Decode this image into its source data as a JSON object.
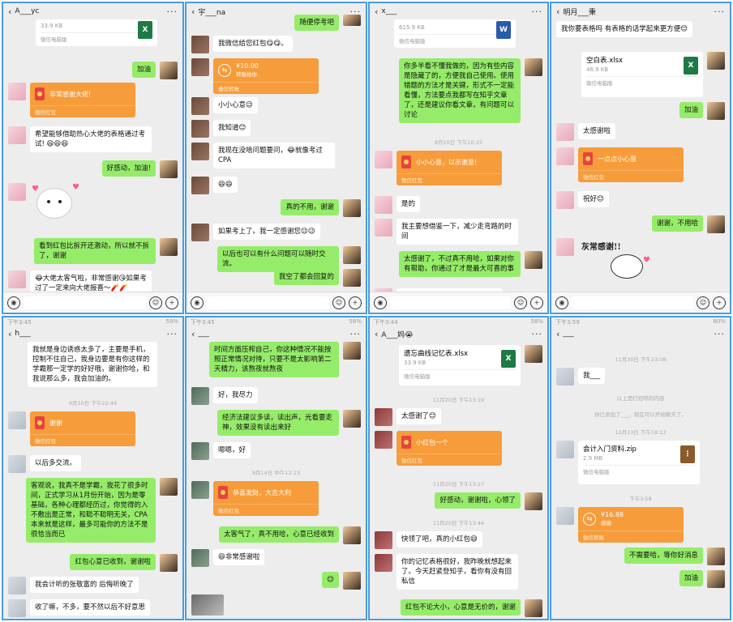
{
  "panels": [
    {
      "title": "A___yc",
      "messages": {
        "file_size": "33.9 KB",
        "file_source": "微信电脑版",
        "m1": "加油",
        "rp1": "非常感谢大佬!",
        "rp_label": "微信红包",
        "m2": "希望能够借助热心大佬的表格通过考试! 😆😆😆",
        "m3": "好感动，加油!",
        "m4": "看到红包比拆开还激动，所以就不拆了，谢谢",
        "m5": "😂大佬太客气啦，非常感谢😘如果考过了一定来向大佬报喜～🧨🧨"
      }
    },
    {
      "title": "宇___na",
      "messages": {
        "m0": "随便停考吧",
        "m1": "我微信给您红包😋😋。",
        "xfer_amount": "¥10.00",
        "xfer_label": "转账给你",
        "xfer_foot": "微信转账",
        "m2": "小小心意😉",
        "m3": "我知道😊",
        "m4": "我现在没啥问题要问，😂就像考过CPA",
        "m5": "😆😆",
        "m6": "真的不用，谢谢",
        "m7": "如果考上了。我一定感谢您😉😉",
        "m8": "以后也可以有什么问题可以随时交流。",
        "m9": "我空了都会回复的"
      }
    },
    {
      "title": "x___",
      "messages": {
        "file_size": "615.9 KB",
        "file_source": "微信电脑版",
        "m1": "你多半看不懂我做的，因为有些内容是隐藏了的，方便我自己使用。使用错题的方法才是关键，形式不一定能看懂，方法要点我都写在知乎文章了，还是建议你看文章，有问题可以讨论",
        "time": "8月10日 下午10:25",
        "rp1": "小小心意，以示谢意!",
        "rp_label": "微信红包",
        "m2": "是的",
        "m3": "我主要想借鉴一下，减少走弯路的时间",
        "m4": "太感谢了，不过真不用哈，如果对你有帮助，你通过了才是最大可喜的事",
        "m5": "我下是多分这文面的，我是老中"
      }
    },
    {
      "title": "明月___秉",
      "messages": {
        "m0": "我你要表格吗 有表格的话学起来更方便😊",
        "file_name": "空白表.xlsx",
        "file_size": "46.9 KB",
        "file_source": "微信电脑版",
        "m1": "加油",
        "m2": "太感谢啦",
        "rp1": "一点点小心意",
        "rp_label": "微信红包",
        "m3": "祝好😊",
        "m4": "谢谢，不用哈",
        "sticker_text": "灰常感谢!!"
      }
    },
    {
      "status_time": "下午3:45",
      "status_right": "59%",
      "title": "h___",
      "messages": {
        "m0": "我就是身边诱惑太多了，主要是手机，控制不住自己，我身边要是有你这样的学霸那一定学的好好哦，谢谢你哈，和我说那么多，我会加油的。",
        "time": "9月10日 下午22:49",
        "rp1": "谢谢",
        "rp_label": "微信红包",
        "m1": "以后多交流。",
        "m2": "客观说，我真不是学霸，我花了很多时间，正式学习从1月份开始，因为是零基础，各种心理都经历过，你觉得的入不敷出是正常，和聪不聪明无关，CPA 本来就是这样，最多可能你的方法不是很恰当而已",
        "m3": "红包心意已收到，谢谢啦",
        "m4": "我会计听的张敬富的 后悔听晚了",
        "m5": "收了嘛，不多，要不然以后不好意思"
      }
    },
    {
      "status_time": "下午3:45",
      "status_right": "58%",
      "title": "___",
      "messages": {
        "m0": "时间方面压榨自己，你这种情况不能按照正常情况对待，只要不是太影响第二天精力，该熬夜就熬夜",
        "m1": "好，我尽力",
        "m2": "经济法建议多读，读出声，光看要走神，效果没有读出来好",
        "m3": "嗯嗯，好",
        "time": "9月14日 中午12:23",
        "rp1": "恭喜发财，大吉大利",
        "rp_label": "微信红包",
        "m4": "太客气了，真不用哈，心意已经收到",
        "m5": "😆非常感谢啦",
        "m6": "😊"
      }
    },
    {
      "status_time": "下午3:44",
      "status_right": "58%",
      "title": "A___妈😭",
      "messages": {
        "file_name": "遗忘曲线记忆表.xlsx",
        "file_size": "33.9 KB",
        "file_source": "微信电脑版",
        "time1": "11月20日 下午13:19",
        "m1": "太感谢了😊",
        "rp1": "小红包一个",
        "rp_label": "微信红包",
        "time2": "11月20日 下午13:27",
        "m2": "好感动，谢谢啦，心领了",
        "time3": "11月20日 下午13:44",
        "m3": "快领了吧，真的小红包😄",
        "m4": "你的记忆表格很好，我昨晚就想起来了。今天赶紧登知乎，看你有没有回私信",
        "m5": "红包不论大小，心意是无价的，谢谢"
      }
    },
    {
      "status_time": "下午3:59",
      "status_right": "80%",
      "title": "___",
      "messages": {
        "time1": "11月30日 下午23:08",
        "m1": "我___",
        "sys1": "以上是打招呼的内容",
        "sys2": "你已添加了___，现在可以开始聊天了。",
        "time2": "12月23日 下午18:12",
        "file_name": "会计入门资料.zip",
        "file_size": "2.9 MB",
        "file_source": "微信电脑版",
        "time3": "下午3:58",
        "xfer_amount": "¥16.88",
        "xfer_label": "感谢",
        "xfer_foot": "微信转账",
        "m2": "不需要哈，等你好消息",
        "m3": "加油"
      }
    }
  ],
  "icons": {
    "back": "‹",
    "more": "···",
    "voice": "◉",
    "emoji": "☺",
    "plus": "+"
  }
}
